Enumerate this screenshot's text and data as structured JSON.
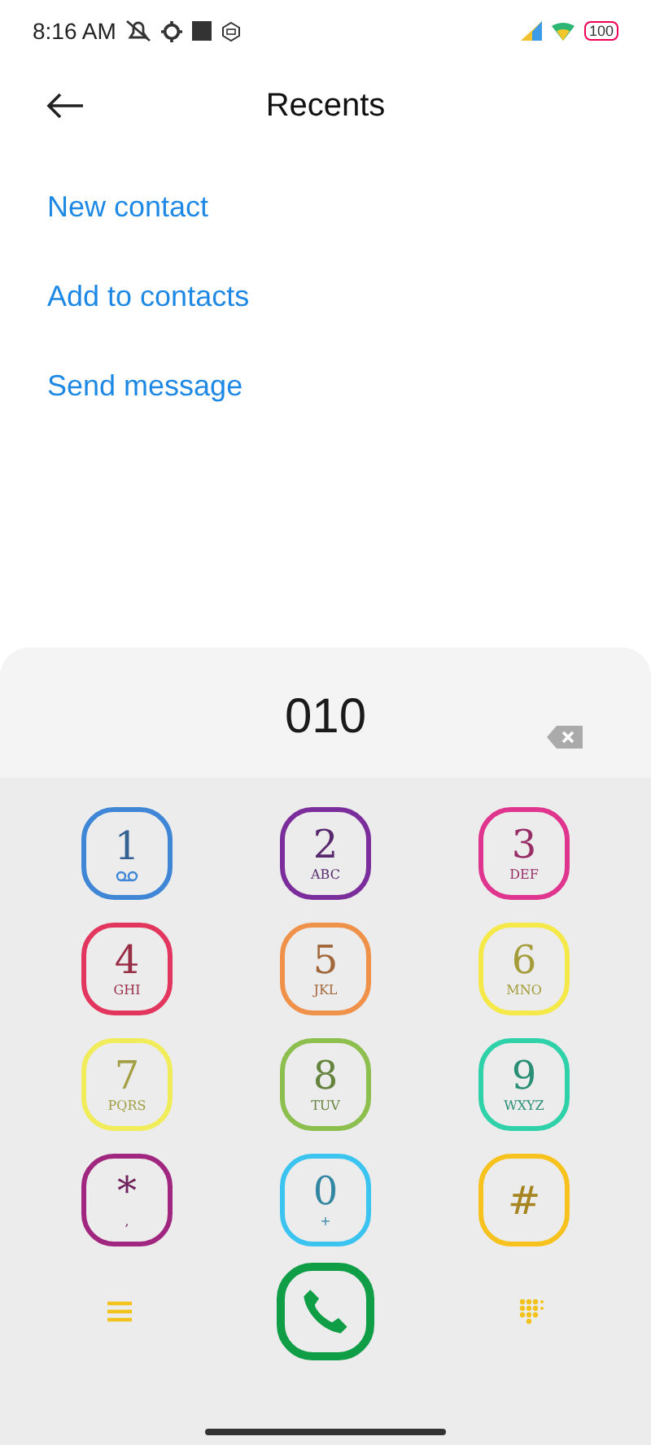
{
  "status_bar": {
    "time": "8:16 AM",
    "battery": "100"
  },
  "header": {
    "title": "Recents"
  },
  "actions": [
    "New contact",
    "Add to contacts",
    "Send message"
  ],
  "dialer": {
    "number": "010",
    "keys": [
      {
        "digit": "1",
        "kind": "voicemail",
        "color": "#3f87d6"
      },
      {
        "digit": "2",
        "kind": "letters",
        "sub": "ABC",
        "color": "#7b2d9c"
      },
      {
        "digit": "3",
        "kind": "letters",
        "sub": "DEF",
        "color": "#e0358f"
      },
      {
        "digit": "4",
        "kind": "letters",
        "sub": "GHI",
        "color": "#e2365e"
      },
      {
        "digit": "5",
        "kind": "letters",
        "sub": "JKL",
        "color": "#f0914a"
      },
      {
        "digit": "6",
        "kind": "letters",
        "sub": "MNO",
        "color": "#f5e94a"
      },
      {
        "digit": "7",
        "kind": "letters",
        "sub": "PQRS",
        "color": "#f0ec5a"
      },
      {
        "digit": "8",
        "kind": "letters",
        "sub": "TUV",
        "color": "#8cbf4e"
      },
      {
        "digit": "9",
        "kind": "letters",
        "sub": "WXYZ",
        "color": "#2ed1a8"
      },
      {
        "digit": "*",
        "kind": "letters",
        "sub": ",",
        "color": "#a0267f"
      },
      {
        "digit": "0",
        "kind": "letters",
        "sub": "+",
        "color": "#3cc4f0"
      },
      {
        "digit": "#",
        "kind": "plain",
        "color": "#f7c21e"
      }
    ]
  }
}
